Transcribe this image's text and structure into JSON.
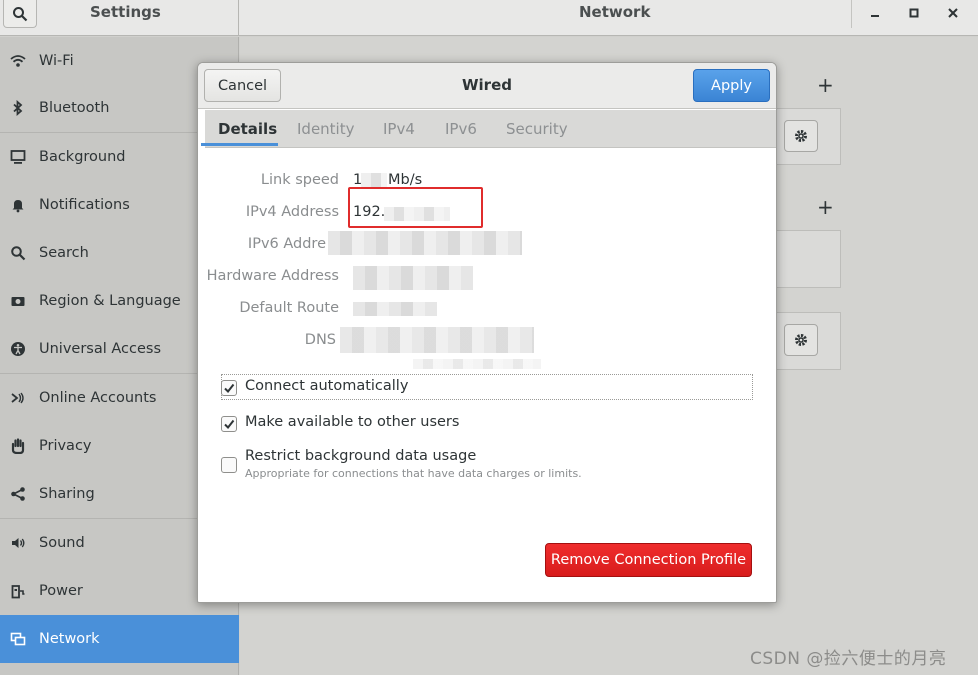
{
  "headerbar": {
    "settings_title": "Settings",
    "panel_title": "Network",
    "search_icon": "search-icon",
    "window_controls": [
      "minimize-icon",
      "maximize-icon",
      "close-icon"
    ]
  },
  "sidebar": {
    "items": [
      {
        "label": "Wi-Fi",
        "icon": "wifi-icon"
      },
      {
        "label": "Bluetooth",
        "icon": "bluetooth-icon"
      },
      {
        "label": "Background",
        "icon": "display-icon"
      },
      {
        "label": "Notifications",
        "icon": "bell-icon"
      },
      {
        "label": "Search",
        "icon": "search-icon"
      },
      {
        "label": "Region & Language",
        "icon": "camera-icon"
      },
      {
        "label": "Universal Access",
        "icon": "accessibility-icon"
      },
      {
        "label": "Online Accounts",
        "icon": "online-accounts-icon"
      },
      {
        "label": "Privacy",
        "icon": "hand-icon"
      },
      {
        "label": "Sharing",
        "icon": "share-icon"
      },
      {
        "label": "Sound",
        "icon": "speaker-icon"
      },
      {
        "label": "Power",
        "icon": "power-icon"
      },
      {
        "label": "Network",
        "icon": "network-icon",
        "selected": true
      }
    ]
  },
  "dialog": {
    "title": "Wired",
    "cancel_label": "Cancel",
    "apply_label": "Apply",
    "tabs": [
      {
        "label": "Details",
        "active": true
      },
      {
        "label": "Identity"
      },
      {
        "label": "IPv4"
      },
      {
        "label": "IPv6"
      },
      {
        "label": "Security"
      }
    ],
    "details": {
      "link_speed_label": "Link speed",
      "link_speed_value_prefix": "1",
      "link_speed_value_unit": "Mb/s",
      "ipv4_label": "IPv4 Address",
      "ipv4_value": "192.",
      "ipv6_label": "IPv6 Addre",
      "hardware_label": "Hardware Address",
      "route_label": "Default Route",
      "dns_label": "DNS"
    },
    "options": {
      "connect_auto": {
        "label": "Connect automatically",
        "checked": true
      },
      "available_others": {
        "label": "Make available to other users",
        "checked": true
      },
      "restrict_bg": {
        "label": "Restrict background data usage",
        "sub": "Appropriate for connections that have data charges or limits.",
        "checked": false
      }
    },
    "remove_label": "Remove Connection Profile"
  },
  "watermark": "CSDN @捡六便士的月亮",
  "colors": {
    "accent": "#4a90d9",
    "destructive": "#e02424",
    "highlight_box": "#e02c2c"
  }
}
